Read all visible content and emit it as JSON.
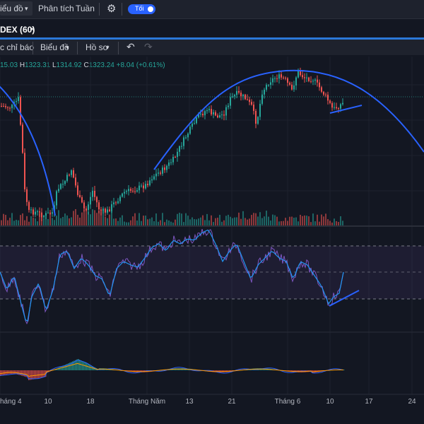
{
  "topbar": {
    "chart_dropdown_label": "iểu đồ",
    "analysis_label": "Phân tích",
    "interval_label": "Tuần",
    "theme_toggle_label": "Tối"
  },
  "tab": {
    "label": "DEX (60)",
    "close": "×"
  },
  "toolbar": {
    "indicators_label": "c chỉ báo",
    "chart_type_label": "Biểu đồ",
    "profile_label": "Hồ sơ",
    "undo": "↶",
    "redo": "↷"
  },
  "ohlc": {
    "open": "15.03",
    "high_key": "H",
    "high": "1323.31",
    "low_key": "L",
    "low": "1314.92",
    "close_key": "C",
    "close": "1323.24",
    "change": "+8.04 (+0.61%)"
  },
  "xaxis": {
    "ticks": [
      "háng 4",
      "10",
      "18",
      "Tháng Năm",
      "13",
      "21",
      "Tháng 6",
      "10",
      "17",
      "24"
    ]
  },
  "colors": {
    "background": "#131722",
    "up": "#26a69a",
    "down": "#ef5350",
    "curve": "#2962ff",
    "rsi": "#7e57c2",
    "accent": "#2962ff"
  }
}
